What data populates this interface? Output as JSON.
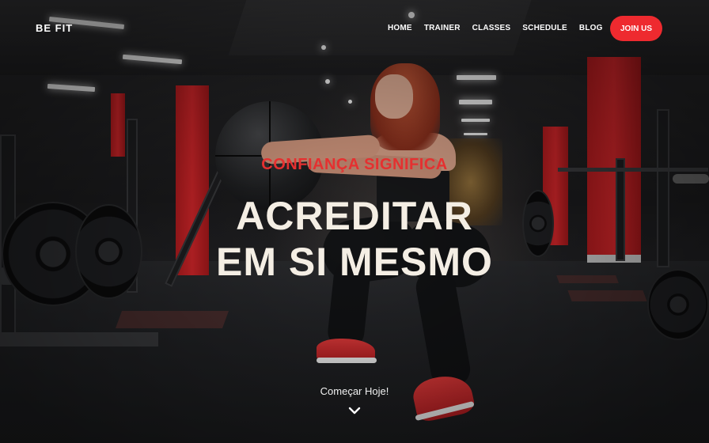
{
  "brand": {
    "name": "BE FIT"
  },
  "nav": {
    "links": [
      "HOME",
      "TRAINER",
      "CLASSES",
      "SCHEDULE",
      "BLOG"
    ],
    "cta_label": "JOIN US"
  },
  "hero": {
    "subtitle": "CONFIANÇA SIGNIFICA",
    "headline_line1": "ACREDITAR",
    "headline_line2": "EM SI MESMO",
    "cta_text": "Começar Hoje!",
    "cta_icon": "chevron-down-icon"
  },
  "colors": {
    "accent": "#ee2a2f",
    "headline": "#f4eee4",
    "nav_text": "#ffffff"
  }
}
